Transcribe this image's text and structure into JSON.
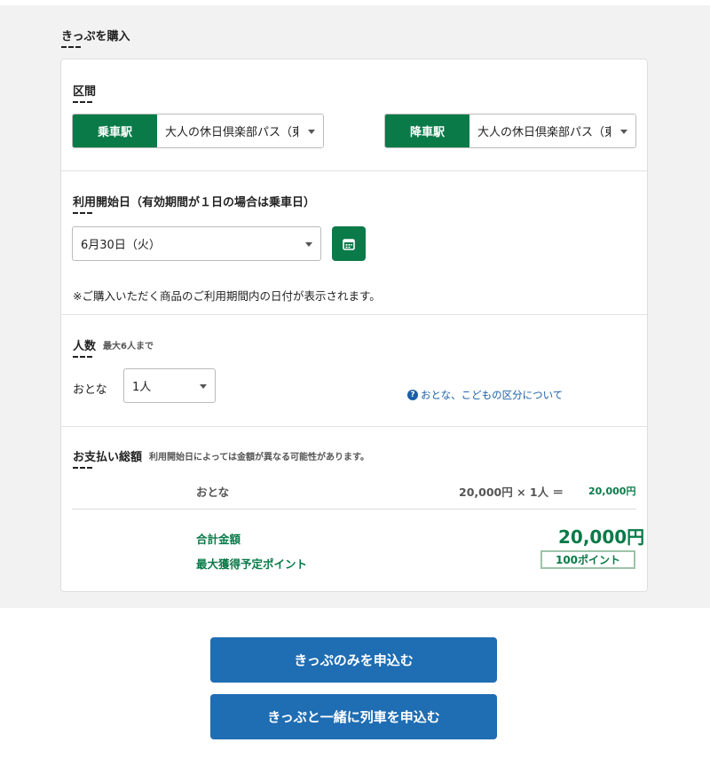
{
  "page": {
    "heading": "きっぷを購入"
  },
  "section_route": {
    "title": "区間",
    "boarding": {
      "label": "乗車駅",
      "value": "大人の休日倶楽部パス（東"
    },
    "alighting": {
      "label": "降車駅",
      "value": "大人の休日倶楽部パス（東"
    }
  },
  "section_date": {
    "title": "利用開始日（有効期間が１日の場合は乗車日）",
    "selected": "6月30日（火）",
    "note": "※ご購入いただく商品のご利用期間内の日付が表示されます。"
  },
  "section_people": {
    "title": "人数",
    "limit": "最大6人まで",
    "adult_label": "おとな",
    "adult_count": "1人",
    "help_link": "おとな、こどもの区分について",
    "help_icon": "?"
  },
  "section_payment": {
    "title": "お支払い総額",
    "note": "利用開始日によっては金額が異なる可能性があります。",
    "adult_label": "おとな",
    "calc": "20,000円 × 1人 ＝",
    "subtotal": "20,000円",
    "total_label": "合計金額",
    "total": "20,000円",
    "points_label": "最大獲得予定ポイント",
    "points": "100ポイント"
  },
  "buttons": {
    "ticket_only": "きっぷのみを申込む",
    "ticket_with_train": "きっぷと一緒に列車を申込む"
  },
  "colors": {
    "green": "#0a7a48",
    "blue": "#1f6db3"
  },
  "icons": {
    "calendar": "calendar-icon",
    "help": "help-icon",
    "dropdown": "chevron-down-icon"
  }
}
